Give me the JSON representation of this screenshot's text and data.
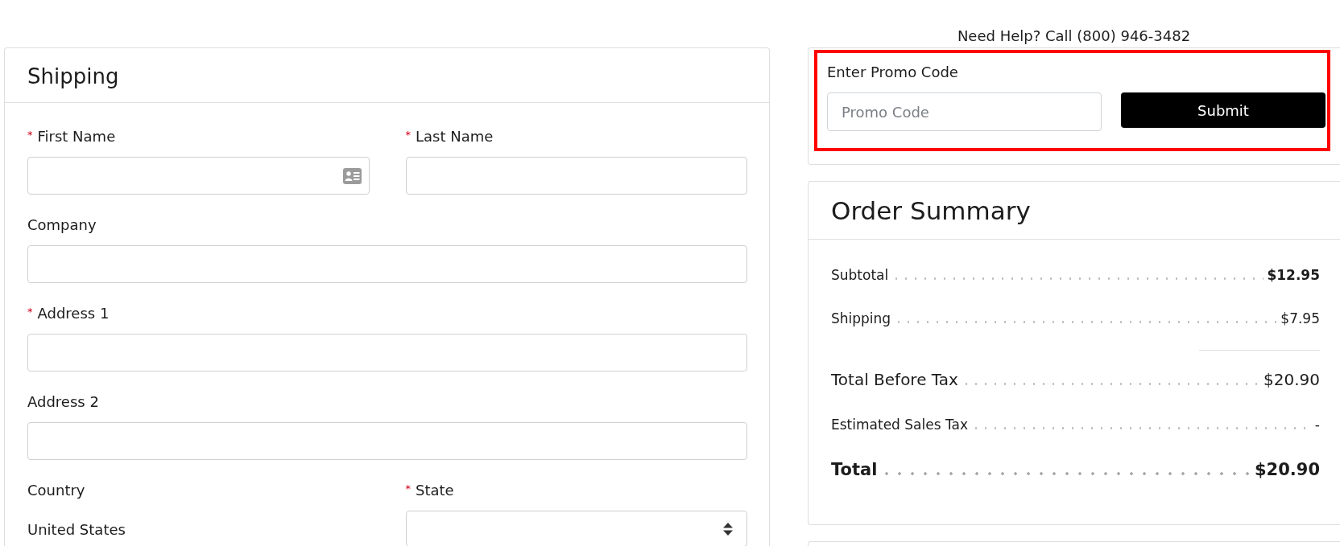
{
  "shipping": {
    "title": "Shipping",
    "rows": [
      {
        "fields": [
          {
            "kind": "input_icon",
            "label": "First Name",
            "required_mark": "*"
          },
          {
            "kind": "input",
            "label": "Last Name",
            "required_mark": "*"
          }
        ]
      },
      {
        "fields": [
          {
            "kind": "input",
            "label": "Company"
          }
        ]
      },
      {
        "fields": [
          {
            "kind": "input",
            "label": "Address 1",
            "required_mark": "*"
          }
        ]
      },
      {
        "fields": [
          {
            "kind": "input",
            "label": "Address 2"
          }
        ]
      },
      {
        "fields": [
          {
            "kind": "static",
            "label": "Country",
            "value": "United States"
          },
          {
            "kind": "select",
            "label": "State",
            "required_mark": "*"
          }
        ]
      }
    ]
  },
  "help": {
    "text": "Need Help? Call (800) 946-3482"
  },
  "promo": {
    "highlighted": true,
    "label": "Enter Promo Code",
    "placeholder": "Promo Code",
    "button": "Submit"
  },
  "order_summary": {
    "title": "Order Summary",
    "rows": [
      {
        "kind": "line",
        "label": "Subtotal",
        "value": "$12.95",
        "value_bold": true
      },
      {
        "kind": "line",
        "label": "Shipping",
        "value": "$7.95",
        "value_bold": false
      },
      {
        "kind": "subtotal",
        "label": "Total Before Tax",
        "value": "$20.90"
      },
      {
        "kind": "line",
        "label": "Estimated Sales Tax",
        "value": "-",
        "value_bold": false
      },
      {
        "kind": "total",
        "label": "Total",
        "value": "$20.90"
      }
    ]
  }
}
